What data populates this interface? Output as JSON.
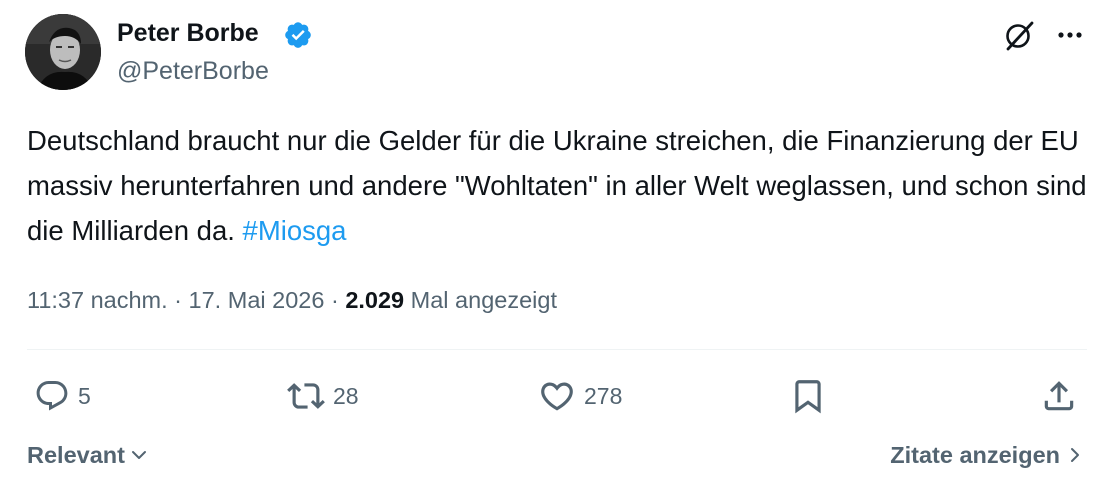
{
  "author": {
    "display_name": "Peter Borbe",
    "handle": "@PeterBorbe",
    "verified": true,
    "verified_color": "#1d9bf0"
  },
  "header_icons": {
    "grok": "grok-icon",
    "more": "more-icon"
  },
  "tweet": {
    "text": "Deutschland braucht nur die Gelder für die Ukraine streichen, die Finanzierung der EU massiv herunterfahren und andere \"Wohltaten\" in aller Welt weglassen, und schon sind die Milliarden da. ",
    "hashtag": "#Miosga",
    "hashtag_color": "#1d9bf0"
  },
  "meta": {
    "time": "11:37 nachm.",
    "separator": " · ",
    "date": "17. Mai 2026",
    "views_count": "2.029",
    "views_label": "Mal angezeigt"
  },
  "actions": {
    "replies": {
      "icon": "reply-icon",
      "count": "5"
    },
    "reposts": {
      "icon": "repost-icon",
      "count": "28"
    },
    "likes": {
      "icon": "like-icon",
      "count": "278"
    },
    "bookmark": {
      "icon": "bookmark-icon"
    },
    "share": {
      "icon": "share-icon"
    }
  },
  "footer": {
    "sort_label": "Relevant",
    "quotes_label": "Zitate anzeigen"
  },
  "colors": {
    "text_primary": "#0f1419",
    "text_secondary": "#536471",
    "divider": "#eff3f4"
  }
}
